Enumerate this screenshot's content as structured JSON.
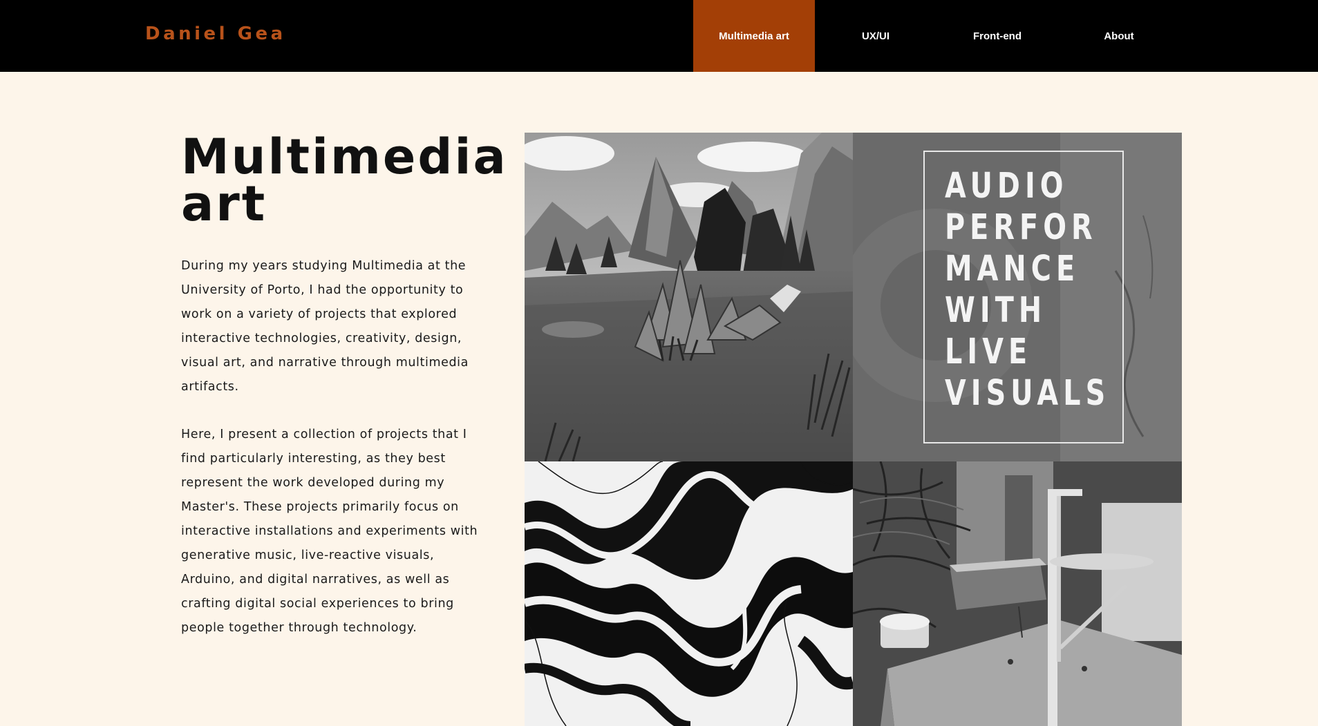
{
  "header": {
    "brand": "Daniel Gea",
    "nav": [
      {
        "label": "Multimedia art",
        "active": true
      },
      {
        "label": "UX/UI",
        "active": false
      },
      {
        "label": "Front-end",
        "active": false
      },
      {
        "label": "About",
        "active": false
      }
    ]
  },
  "main": {
    "title": "Multimedia art",
    "paragraphs": [
      "During my years studying Multimedia at the University of Porto, I had the opportunity to work on a variety of projects that explored interactive technologies, creativity, design, visual art, and narrative through multimedia artifacts.",
      "Here, I present a collection of projects that I find particularly interesting, as they best represent the work developed during my Master's. These projects primarily focus on interactive installations and experiments with generative music, live-reactive visuals, Arduino, and digital narratives, as well as crafting digital social experiences to bring people together through technology."
    ]
  },
  "gallery": {
    "poster_lines": [
      "AUDIO",
      "PERFOR",
      "MANCE",
      "WITH",
      "LIVE",
      "VISUALS"
    ]
  },
  "colors": {
    "accent": "#a33f06",
    "brand": "#b8521a",
    "background": "#fdf5ea",
    "header": "#000000"
  }
}
